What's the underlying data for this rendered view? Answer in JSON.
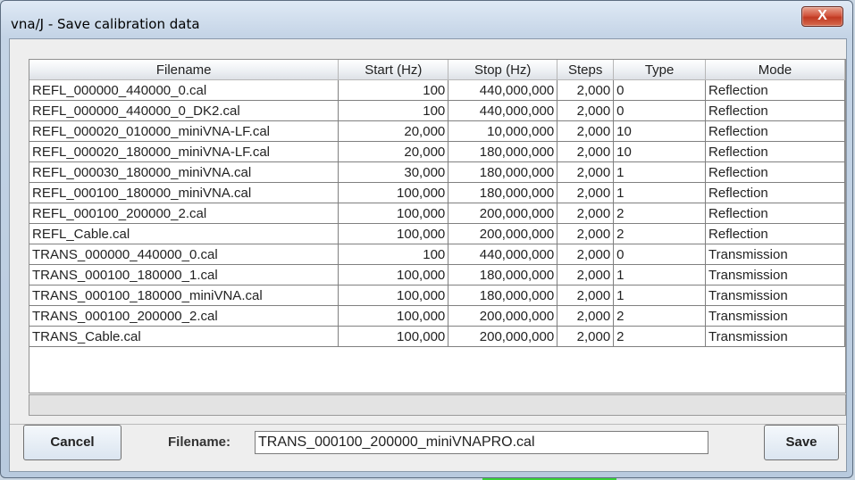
{
  "window": {
    "title": "vna/J - Save calibration data",
    "close_glyph": "X"
  },
  "table": {
    "columns": [
      "Filename",
      "Start (Hz)",
      "Stop (Hz)",
      "Steps",
      "Type",
      "Mode"
    ],
    "rows": [
      [
        "REFL_000000_440000_0.cal",
        "100",
        "440,000,000",
        "2,000",
        "0",
        "Reflection"
      ],
      [
        "REFL_000000_440000_0_DK2.cal",
        "100",
        "440,000,000",
        "2,000",
        "0",
        "Reflection"
      ],
      [
        "REFL_000020_010000_miniVNA-LF.cal",
        "20,000",
        "10,000,000",
        "2,000",
        "10",
        "Reflection"
      ],
      [
        "REFL_000020_180000_miniVNA-LF.cal",
        "20,000",
        "180,000,000",
        "2,000",
        "10",
        "Reflection"
      ],
      [
        "REFL_000030_180000_miniVNA.cal",
        "30,000",
        "180,000,000",
        "2,000",
        "1",
        "Reflection"
      ],
      [
        "REFL_000100_180000_miniVNA.cal",
        "100,000",
        "180,000,000",
        "2,000",
        "1",
        "Reflection"
      ],
      [
        "REFL_000100_200000_2.cal",
        "100,000",
        "200,000,000",
        "2,000",
        "2",
        "Reflection"
      ],
      [
        "REFL_Cable.cal",
        "100,000",
        "200,000,000",
        "2,000",
        "2",
        "Reflection"
      ],
      [
        "TRANS_000000_440000_0.cal",
        "100",
        "440,000,000",
        "2,000",
        "0",
        "Transmission"
      ],
      [
        "TRANS_000100_180000_1.cal",
        "100,000",
        "180,000,000",
        "2,000",
        "1",
        "Transmission"
      ],
      [
        "TRANS_000100_180000_miniVNA.cal",
        "100,000",
        "180,000,000",
        "2,000",
        "1",
        "Transmission"
      ],
      [
        "TRANS_000100_200000_2.cal",
        "100,000",
        "200,000,000",
        "2,000",
        "2",
        "Transmission"
      ],
      [
        "TRANS_Cable.cal",
        "100,000",
        "200,000,000",
        "2,000",
        "2",
        "Transmission"
      ]
    ]
  },
  "footer": {
    "cancel_label": "Cancel",
    "filename_label": "Filename:",
    "filename_value": "TRANS_000100_200000_miniVNAPRO.cal",
    "save_label": "Save"
  }
}
